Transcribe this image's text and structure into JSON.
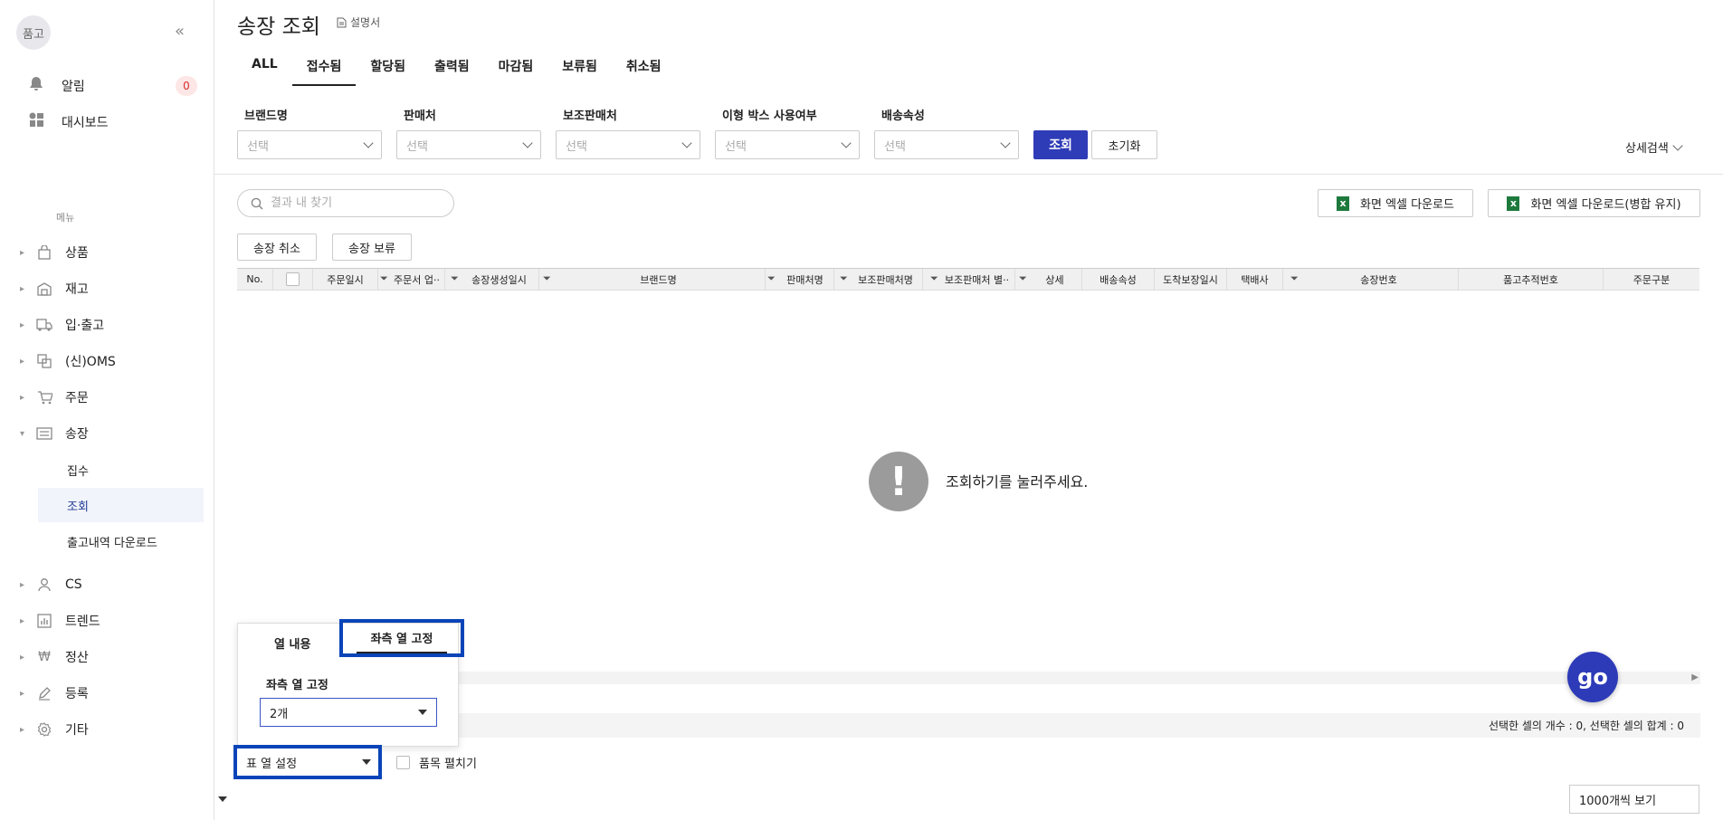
{
  "sidebar": {
    "logo": "품고",
    "alerts_label": "알림",
    "alerts_count": "0",
    "dashboard_label": "대시보드",
    "menu_caption": "메뉴",
    "items": [
      {
        "label": "상품",
        "icon": "bag-icon"
      },
      {
        "label": "재고",
        "icon": "warehouse-icon"
      },
      {
        "label": "입·출고",
        "icon": "truck-icon"
      },
      {
        "label": "(신)OMS",
        "icon": "oms-icon"
      },
      {
        "label": "주문",
        "icon": "cart-icon"
      },
      {
        "label": "송장",
        "icon": "invoice-icon"
      }
    ],
    "sub_items": [
      "집수",
      "조회",
      "출고내역 다운로드"
    ],
    "items_after": [
      {
        "label": "CS",
        "icon": "person-icon"
      },
      {
        "label": "트렌드",
        "icon": "chart-icon"
      },
      {
        "label": "정산",
        "icon": "won-icon"
      },
      {
        "label": "등록",
        "icon": "pencil-icon"
      },
      {
        "label": "기타",
        "icon": "gear-icon"
      }
    ]
  },
  "header": {
    "title": "송장 조회",
    "doc_link": "설명서"
  },
  "tabs": [
    "ALL",
    "접수됨",
    "할당됨",
    "출력됨",
    "마감됨",
    "보류됨",
    "취소됨"
  ],
  "filters": [
    {
      "label": "브랜드명",
      "placeholder": "선택"
    },
    {
      "label": "판매처",
      "placeholder": "선택"
    },
    {
      "label": "보조판매처",
      "placeholder": "선택"
    },
    {
      "label": "이형 박스 사용여부",
      "placeholder": "선택"
    },
    {
      "label": "배송속성",
      "placeholder": "선택"
    }
  ],
  "buttons": {
    "search": "조회",
    "reset": "초기화",
    "detail_search": "상세검색",
    "excel_download": "화면 엑셀 다운로드",
    "excel_download_merge": "화면 엑셀 다운로드(병합 유지)",
    "cancel_invoice": "송장 취소",
    "hold_invoice": "송장 보류"
  },
  "search": {
    "placeholder": "결과 내 찾기"
  },
  "grid": {
    "columns": [
      "No.",
      "주문일시",
      "주문서 업··",
      "송장생성일시",
      "브랜드명",
      "판매처명",
      "보조판매처명",
      "보조판매처 별··",
      "상세",
      "배송속성",
      "도착보장일시",
      "택배사",
      "송장번호",
      "품고추적번호",
      "주문구분"
    ],
    "empty_message": "조회하기를 눌러주세요."
  },
  "popup": {
    "tab_content": "열 내용",
    "tab_freeze": "좌측 열 고정",
    "freeze_label": "좌측 열 고정",
    "freeze_value": "2개"
  },
  "footer": {
    "status": "선택한 셀의 개수 : 0, 선택한 셀의 합계 : 0",
    "table_setting": "표 열 설정",
    "expand_items": "품목 펼치기",
    "per_page": "1000개씩 보기"
  },
  "colors": {
    "accent": "#2f3cb7",
    "highlight": "#0a44b8",
    "badge": "#d92d2d"
  }
}
